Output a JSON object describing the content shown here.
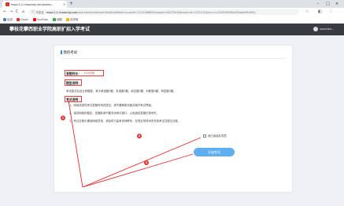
{
  "browser": {
    "tab_title": "mooc1-2.chaoxing.com/exam/...",
    "tab_close": "×",
    "new_tab": "+",
    "window_controls": [
      "–",
      "□",
      "×"
    ],
    "nav": {
      "back": "←",
      "forward": "→",
      "reload": "C",
      "home": "⌂"
    },
    "address": {
      "secure_label": "不安全",
      "host": "mooc1-2.chaoxing.com",
      "path": "/exam/test/reVersionTestStartNew?courseId=221528685&classId=46279438&examId=1570133&enc=cc5287e81f6e455addf4fcb92c"
    },
    "bookmarks": [
      "应用",
      "Gmail",
      "YouTube",
      "地图",
      "自学网"
    ]
  },
  "site": {
    "title": "攀枝花攀西职业学院高职扩招入学考试",
    "user_name": "xuechen..."
  },
  "exam": {
    "heading": "我的考试",
    "time_label": "答题时长：",
    "time_value": "120分钟",
    "desc_label": "题型说明：",
    "desc_text": "考试卷共包含五种题型，其中单选题3题，多选题3题，填空题3题，判断题3题，简答题3题。",
    "notice_label": "考试说明：",
    "notices": [
      "1、网络成绩在考试答题时间内提交，请不要刷新页面并离开考试界面。",
      "2、保持网络的稳定，答题前请不要关闭考试窗口，以免造成答题记录丢失。",
      "3、考试过程中遇到网络异常，请及时与监考老师联系，在规定的时间内完成考试并提交试卷。"
    ],
    "checkbox_label": "我已阅读并同意",
    "start_button": "开始考试"
  },
  "markers": [
    "1",
    "2",
    "3"
  ],
  "colors": {
    "header_bg": "#383c41",
    "button": "#5faef0",
    "annotation": "#e23232"
  }
}
